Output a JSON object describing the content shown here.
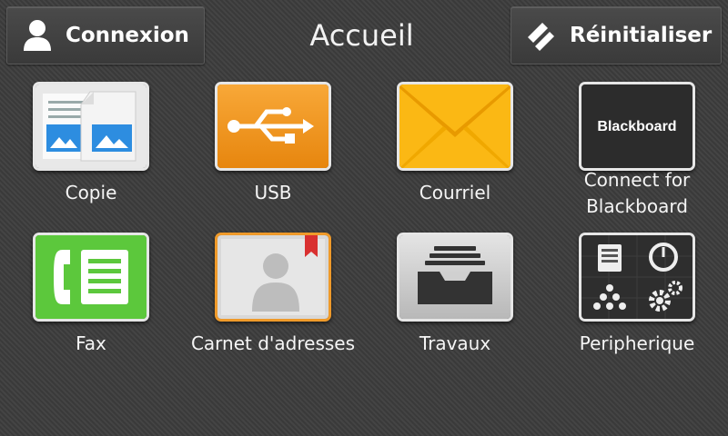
{
  "header": {
    "title": "Accueil",
    "login_label": "Connexion",
    "reset_label": "Réinitialiser"
  },
  "apps": [
    {
      "label": "Copie",
      "icon": "copy-icon"
    },
    {
      "label": "USB",
      "icon": "usb-icon"
    },
    {
      "label": "Courriel",
      "icon": "email-envelope-icon"
    },
    {
      "label": "Connect for Blackboard",
      "icon": "blackboard-icon",
      "icon_text": "Blackboard"
    },
    {
      "label": "Fax",
      "icon": "fax-icon"
    },
    {
      "label": "Carnet d'adresses",
      "icon": "address-book-icon"
    },
    {
      "label": "Travaux",
      "icon": "jobs-tray-icon"
    },
    {
      "label": "Peripherique",
      "icon": "device-icon"
    }
  ],
  "colors": {
    "background": "#3d3d3d",
    "usb": "#f0961e",
    "email": "#fbb814",
    "fax": "#5cc83c",
    "blackboard": "#2c2c2c"
  }
}
